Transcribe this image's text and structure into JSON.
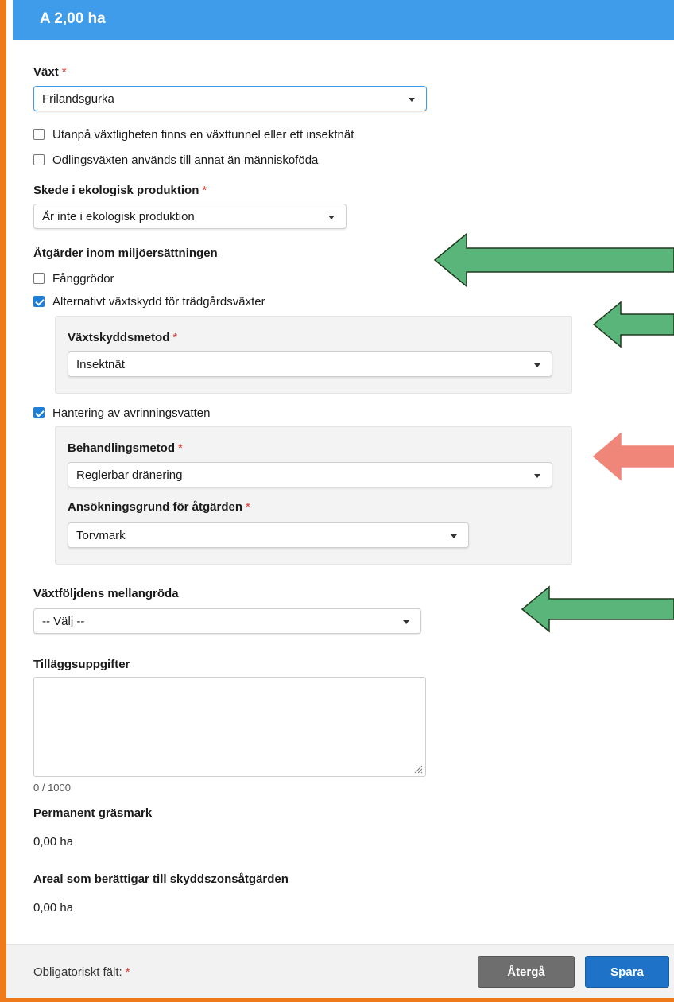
{
  "header": {
    "title": "A 2,00 ha"
  },
  "required_marker": "*",
  "vaxt": {
    "label": "Växt",
    "value": "Frilandsgurka",
    "option_tunnel": "Utanpå växtligheten finns en växttunnel eller ett insektnät",
    "option_tunnel_checked": false,
    "option_annat": "Odlingsväxten används till annat än människoföda",
    "option_annat_checked": false
  },
  "skede": {
    "label": "Skede i ekologisk produktion",
    "value": "Är inte i ekologisk produktion"
  },
  "atgarder": {
    "label": "Åtgärder inom miljöersättningen",
    "fanggrodor": {
      "label": "Fånggrödor",
      "checked": false
    },
    "vaxtskydd": {
      "label": "Alternativt växtskydd för trädgårdsväxter",
      "checked": true,
      "method_label": "Växtskyddsmetod",
      "method_value": "Insektnät"
    },
    "avrinning": {
      "label": "Hantering av avrinningsvatten",
      "checked": true,
      "behandling_label": "Behandlingsmetod",
      "behandling_value": "Reglerbar dränering",
      "grund_label": "Ansökningsgrund för åtgärden",
      "grund_value": "Torvmark"
    }
  },
  "mellangroda": {
    "label": "Växtföljdens mellangröda",
    "value": "-- Välj --"
  },
  "tillagg": {
    "label": "Tilläggsuppgifter",
    "value": "",
    "counter": "0 / 1000"
  },
  "permanent": {
    "label": "Permanent gräsmark",
    "value": "0,00 ha"
  },
  "skyddszon": {
    "label": "Areal som berättigar till skyddszonsåtgärden",
    "value": "0,00 ha"
  },
  "footer": {
    "required_note": "Obligatoriskt fält:",
    "back_label": "Återgå",
    "save_label": "Spara"
  },
  "colors": {
    "header": "#3f9cea",
    "frame": "#ef7a1a",
    "required": "#d9342b",
    "arrow_green": "#5ab57b",
    "arrow_red": "#f0857a",
    "save": "#1e73c8",
    "back": "#6e6e6e"
  },
  "annotations": [
    {
      "icon": "green-arrow-left-icon"
    },
    {
      "icon": "green-arrow-left-icon"
    },
    {
      "icon": "red-arrow-left-icon"
    },
    {
      "icon": "green-arrow-left-icon"
    }
  ]
}
